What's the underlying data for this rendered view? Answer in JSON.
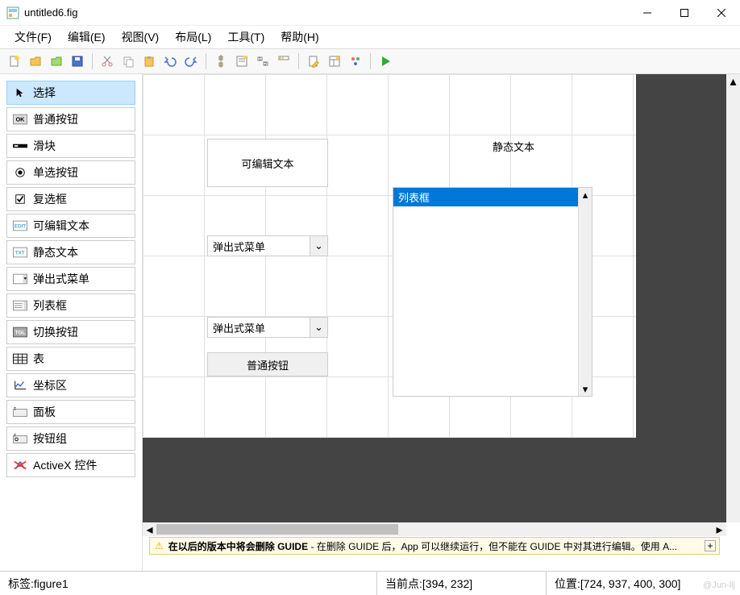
{
  "window": {
    "title": "untitled6.fig"
  },
  "menus": [
    "文件(F)",
    "编辑(E)",
    "视图(V)",
    "布局(L)",
    "工具(T)",
    "帮助(H)"
  ],
  "palette": [
    {
      "label": "选择",
      "icon": "cursor",
      "selected": true
    },
    {
      "label": "普通按钮",
      "icon": "ok"
    },
    {
      "label": "滑块",
      "icon": "slider"
    },
    {
      "label": "单选按钮",
      "icon": "radio"
    },
    {
      "label": "复选框",
      "icon": "checkbox"
    },
    {
      "label": "可编辑文本",
      "icon": "edit"
    },
    {
      "label": "静态文本",
      "icon": "txt"
    },
    {
      "label": "弹出式菜单",
      "icon": "popup"
    },
    {
      "label": "列表框",
      "icon": "listbox"
    },
    {
      "label": "切换按钮",
      "icon": "toggle"
    },
    {
      "label": "表",
      "icon": "table"
    },
    {
      "label": "坐标区",
      "icon": "axes"
    },
    {
      "label": "面板",
      "icon": "panel"
    },
    {
      "label": "按钮组",
      "icon": "btngroup"
    },
    {
      "label": "ActiveX 控件",
      "icon": "activex"
    }
  ],
  "canvas": {
    "edit_text": "可编辑文本",
    "static_text": "静态文本",
    "popup1": "弹出式菜单",
    "popup2": "弹出式菜单",
    "pushbutton": "普通按钮",
    "listbox_item": "列表框"
  },
  "notice": {
    "bold": "在以后的版本中将会删除 GUIDE",
    "rest": " - 在删除 GUIDE 后，App 可以继续运行，但不能在 GUIDE 中对其进行编辑。使用 A..."
  },
  "status": {
    "tag_label": "标签: ",
    "tag_value": "figure1",
    "current_label": "当前点:  ",
    "current_value": "[394, 232]",
    "pos_label": "位置: ",
    "pos_value": "[724, 937, 400, 300]"
  },
  "watermark": "@Jun-llj"
}
